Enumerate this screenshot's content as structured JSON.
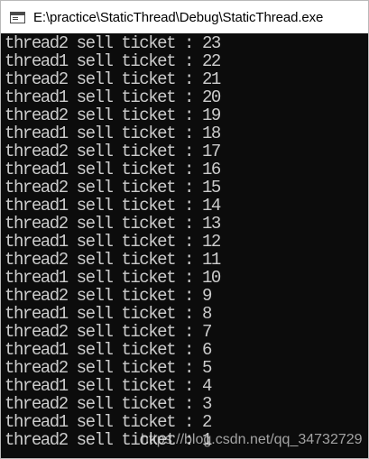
{
  "window": {
    "title": "E:\\practice\\StaticThread\\Debug\\StaticThread.exe",
    "icon": "console-window-icon"
  },
  "console": {
    "lines": [
      "thread2 sell ticket : 23",
      "thread1 sell ticket : 22",
      "thread2 sell ticket : 21",
      "thread1 sell ticket : 20",
      "thread2 sell ticket : 19",
      "thread1 sell ticket : 18",
      "thread2 sell ticket : 17",
      "thread1 sell ticket : 16",
      "thread2 sell ticket : 15",
      "thread1 sell ticket : 14",
      "thread2 sell ticket : 13",
      "thread1 sell ticket : 12",
      "thread2 sell ticket : 11",
      "thread1 sell ticket : 10",
      "thread2 sell ticket : 9",
      "thread1 sell ticket : 8",
      "thread2 sell ticket : 7",
      "thread1 sell ticket : 6",
      "thread2 sell ticket : 5",
      "thread1 sell ticket : 4",
      "thread2 sell ticket : 3",
      "thread1 sell ticket : 2",
      "thread2 sell ticket : 1"
    ],
    "text_color": "#cccccc",
    "background": "#0c0c0c"
  },
  "watermark": "https://blog.csdn.net/qq_34732729"
}
